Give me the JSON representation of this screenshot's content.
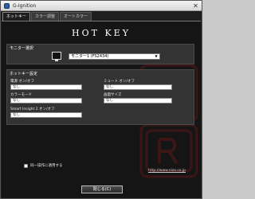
{
  "window": {
    "title": "G-Ignition",
    "close_glyph": "✕"
  },
  "tabs": [
    {
      "label": "ホットキー",
      "active": true
    },
    {
      "label": "カラー調整",
      "active": false
    },
    {
      "label": "オートカラー",
      "active": false
    }
  ],
  "hotkey_title": "HOT KEY",
  "monitor_section": {
    "label": "モニター選択",
    "selected": "モニター1 (FS2434)",
    "arrow": "▼"
  },
  "hotkey_section": {
    "label": "ホットキー設定",
    "fields": [
      {
        "label": "電源 オン/オフ",
        "value": "なし"
      },
      {
        "label": "ミュート オン/オフ",
        "value": "なし"
      },
      {
        "label": "カラーモード",
        "value": "なし"
      },
      {
        "label": "画面サイズ",
        "value": "なし"
      },
      {
        "label": "Smart Insight 2 オン/オフ",
        "value": "なし"
      }
    ]
  },
  "apply_all": {
    "label": "同一操作に適用する",
    "checked": false
  },
  "link": {
    "text": "http://www.eizo.co.jp"
  },
  "close_button": {
    "label": "閉じる(C)"
  },
  "colors": {
    "background": "#151515",
    "panel": "#333333",
    "watermark": "#a31c1c"
  }
}
